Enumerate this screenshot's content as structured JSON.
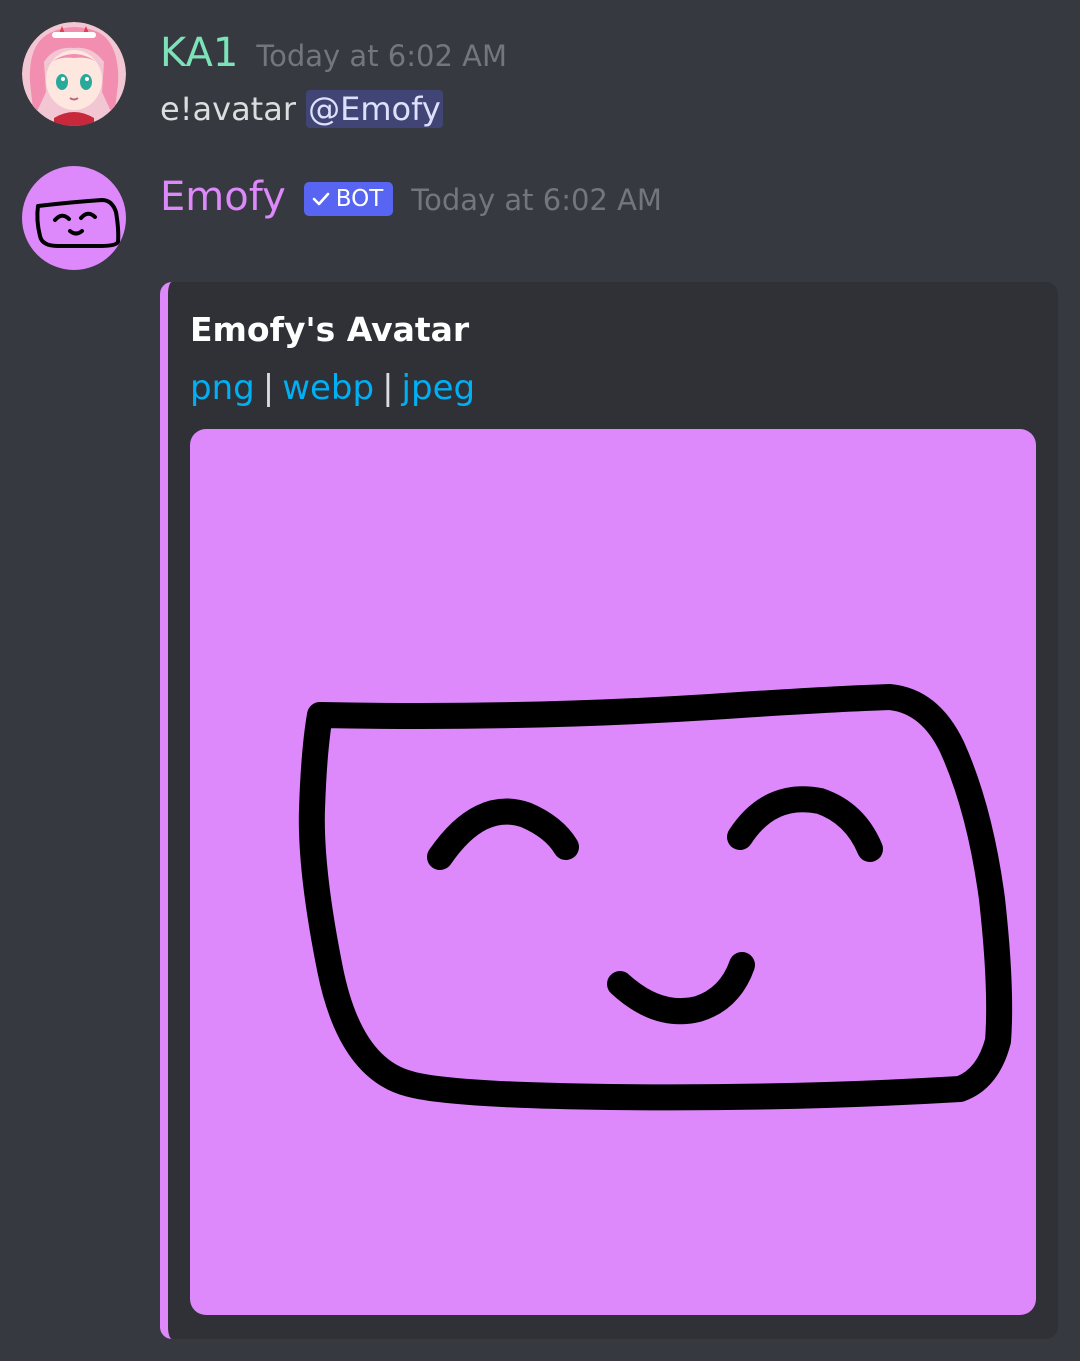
{
  "messages": [
    {
      "username": "KA1",
      "username_color": "#7ce3b9",
      "timestamp": "Today at 6:02 AM",
      "content_prefix": "e!avatar",
      "mention": "@Emofy"
    },
    {
      "username": "Emofy",
      "username_color": "#dd88fb",
      "bot_tag": "BOT",
      "timestamp": "Today at 6:02 AM",
      "embed": {
        "accent_color": "#dd88fb",
        "title": "Emofy's Avatar",
        "links": [
          "png",
          "webp",
          "jpeg"
        ],
        "separator": "|",
        "image_icon": "emofy-face-avatar"
      }
    }
  ]
}
